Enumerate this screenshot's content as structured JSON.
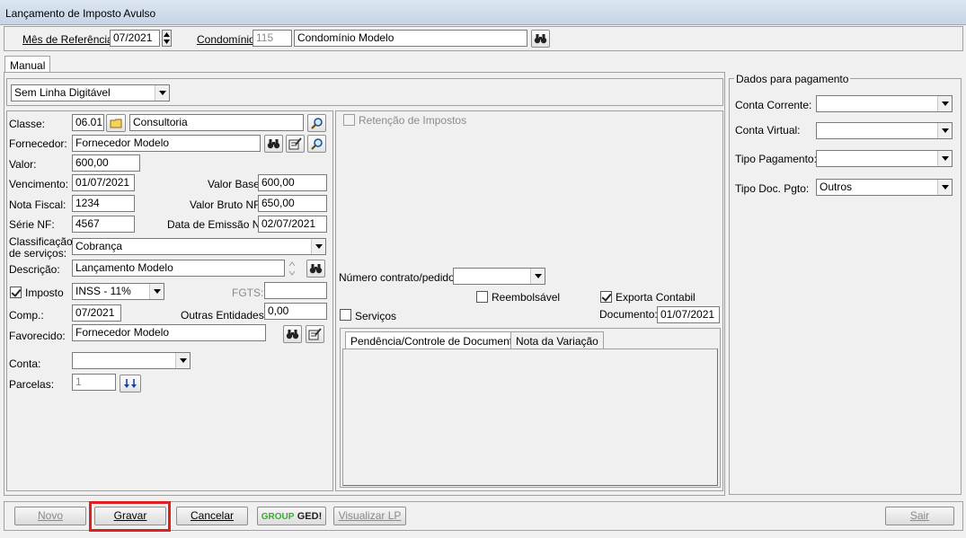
{
  "window": {
    "title": "Lançamento de Imposto Avulso"
  },
  "header": {
    "mes_label": "Mês de Referência:",
    "mes_value": "07/2021",
    "condominio_label": "Condomínio:",
    "condominio_code": "115",
    "condominio_name": "Condomínio Modelo"
  },
  "tabs": {
    "manual": "Manual"
  },
  "linha_digitavel": {
    "selected": "Sem Linha Digitável"
  },
  "form": {
    "classe_label": "Classe:",
    "classe_code": "06.01",
    "classe_name": "Consultoria",
    "fornecedor_label": "Fornecedor:",
    "fornecedor_value": "Fornecedor Modelo",
    "valor_label": "Valor:",
    "valor_value": "600,00",
    "vencimento_label": "Vencimento:",
    "vencimento_value": "01/07/2021",
    "valor_base_label": "Valor Base:",
    "valor_base_value": "600,00",
    "nota_fiscal_label": "Nota Fiscal:",
    "nota_fiscal_value": "1234",
    "valor_bruto_label": "Valor Bruto NF:",
    "valor_bruto_value": "650,00",
    "serie_label": "Série NF:",
    "serie_value": "4567",
    "data_emissao_label": "Data de Emissão NF:",
    "data_emissao_value": "02/07/2021",
    "classificacao_label_1": "Classificação",
    "classificacao_label_2": "de serviços:",
    "classificacao_value": "Cobrança",
    "descricao_label": "Descrição:",
    "descricao_value": "Lançamento Modelo",
    "imposto_label": "Imposto",
    "imposto_checked": true,
    "imposto_value": "INSS - 11%",
    "fgts_label": "FGTS:",
    "fgts_value": "",
    "comp_label": "Comp.:",
    "comp_value": "07/2021",
    "outras_label": "Outras Entidades:",
    "outras_value": "0,00",
    "favorecido_label": "Favorecido:",
    "favorecido_value": "Fornecedor Modelo",
    "conta_label": "Conta:",
    "conta_value": "",
    "parcelas_label": "Parcelas:",
    "parcelas_value": "1"
  },
  "middle": {
    "retencao_label": "Retenção de Impostos",
    "numero_contrato_label": "Número contrato/pedido:",
    "numero_contrato_value": "",
    "reembolsavel_label": "Reembolsável",
    "exporta_label": "Exporta Contabil",
    "exporta_checked": true,
    "servicos_label": "Serviços",
    "documento_label": "Documento:",
    "documento_value": "01/07/2021",
    "tab_pendencia": "Pendência/Controle de Documentos",
    "tab_nota": "Nota da Variação"
  },
  "pagamento": {
    "group_title": "Dados para pagamento",
    "conta_corrente_label": "Conta Corrente:",
    "conta_corrente_value": "",
    "conta_virtual_label": "Conta Virtual:",
    "conta_virtual_value": "",
    "tipo_pagamento_label": "Tipo Pagamento:",
    "tipo_pagamento_value": "",
    "tipo_doc_label": "Tipo Doc. Pgto:",
    "tipo_doc_value": "Outros"
  },
  "buttons": {
    "novo": "Novo",
    "gravar": "Gravar",
    "cancelar": "Cancelar",
    "ged_group": "GROUP",
    "ged": "GED!",
    "visualizar": "Visualizar LP",
    "sair": "Sair"
  },
  "colors": {
    "highlight": "#e02020",
    "titlebar": "#c6d4e6"
  }
}
